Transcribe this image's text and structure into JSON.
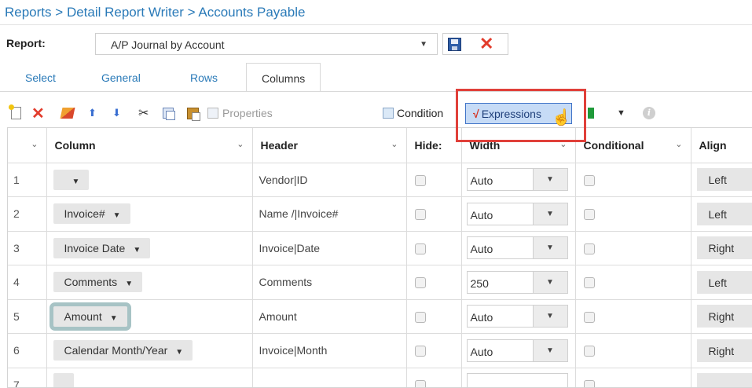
{
  "breadcrumb": {
    "items": [
      "Reports",
      "Detail Report Writer",
      "Accounts Payable"
    ],
    "separator": ">"
  },
  "report": {
    "label": "Report:",
    "selected": "A/P Journal by Account",
    "save_icon": "save-icon",
    "cancel_icon": "cancel-icon"
  },
  "tabs": [
    {
      "label": "Select",
      "active": false
    },
    {
      "label": "General",
      "active": false
    },
    {
      "label": "Rows",
      "active": false
    },
    {
      "label": "Columns",
      "active": true
    }
  ],
  "toolbar": {
    "properties": "Properties",
    "conditions": "Condition",
    "expressions": "Expressions"
  },
  "grid": {
    "headers": [
      "Column",
      "Header",
      "Hide:",
      "Width",
      "Conditional",
      "Align"
    ],
    "rows": [
      {
        "num": "1",
        "column": "",
        "header": "Vendor|ID",
        "width": "Auto",
        "align": "Left"
      },
      {
        "num": "2",
        "column": "Invoice#",
        "header": "Name /|Invoice#",
        "width": "Auto",
        "align": "Left"
      },
      {
        "num": "3",
        "column": "Invoice Date",
        "header": "Invoice|Date",
        "width": "Auto",
        "align": "Right"
      },
      {
        "num": "4",
        "column": "Comments",
        "header": "Comments",
        "width": "250",
        "align": "Left"
      },
      {
        "num": "5",
        "column": "Amount",
        "header": "Amount",
        "width": "Auto",
        "align": "Right"
      },
      {
        "num": "6",
        "column": "Calendar Month/Year",
        "header": "Invoice|Month",
        "width": "Auto",
        "align": "Right"
      },
      {
        "num": "7",
        "column": "",
        "header": "",
        "width": "",
        "align": ""
      }
    ]
  },
  "colors": {
    "link": "#2a7ab8",
    "highlight": "#e0403a",
    "selected_button": "#c6dbf6",
    "delete": "#e23c2c"
  }
}
